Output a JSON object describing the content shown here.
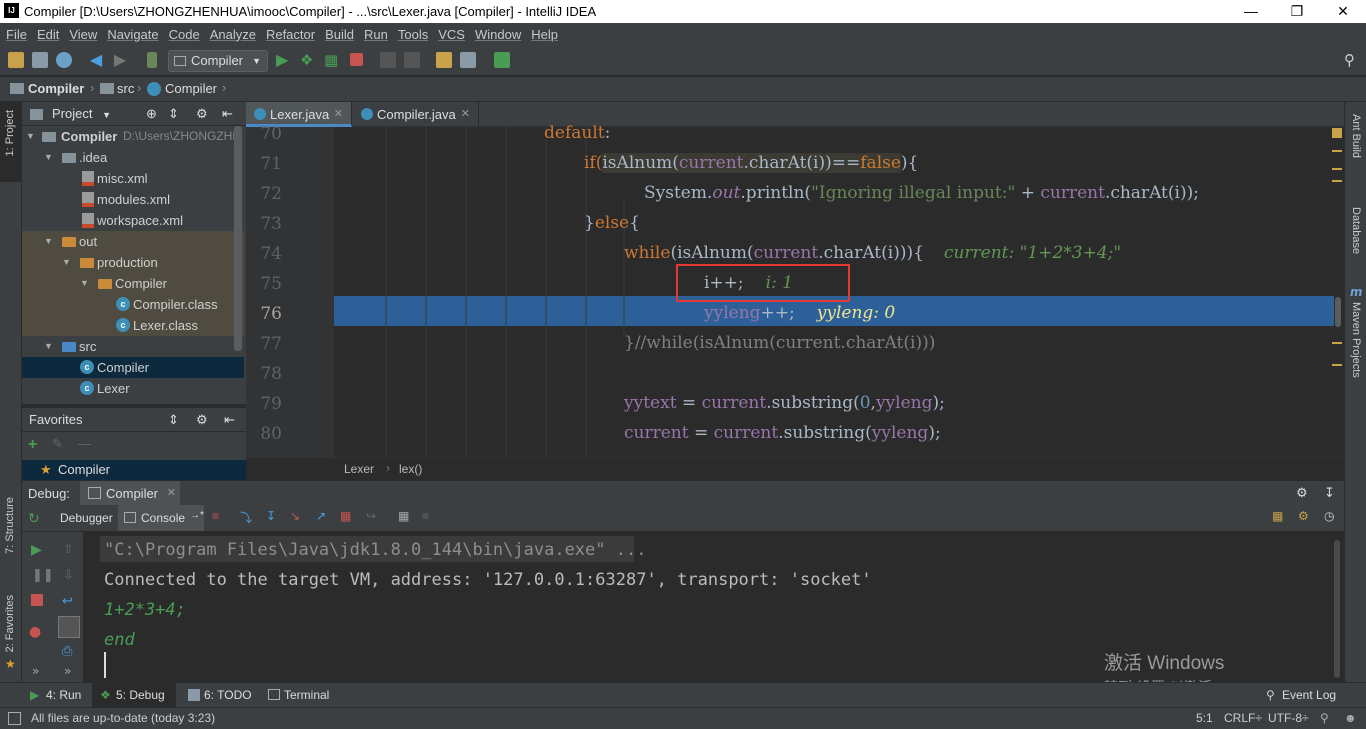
{
  "window": {
    "title": "Compiler [D:\\Users\\ZHONGZHENHUA\\imooc\\Compiler] - ...\\src\\Lexer.java [Compiler] - IntelliJ IDEA",
    "app_icon": "IJ"
  },
  "menu": [
    "File",
    "Edit",
    "View",
    "Navigate",
    "Code",
    "Analyze",
    "Refactor",
    "Build",
    "Run",
    "Tools",
    "VCS",
    "Window",
    "Help"
  ],
  "toolbar": {
    "run_config": "Compiler"
  },
  "navbar": {
    "items": [
      "Compiler",
      "src",
      "Compiler"
    ]
  },
  "left_strip": {
    "project": "1: Project",
    "structure": "7: Structure",
    "favorites": "2: Favorites"
  },
  "right_strip": {
    "ant": "Ant Build",
    "database": "Database",
    "maven": "Maven Projects"
  },
  "project_panel": {
    "title": "Project",
    "root": {
      "name": "Compiler",
      "path": "D:\\Users\\ZHONGZHE"
    },
    "items": [
      ".idea",
      "misc.xml",
      "modules.xml",
      "workspace.xml",
      "out",
      "production",
      "Compiler",
      "Compiler.class",
      "Lexer.class",
      "src",
      "Compiler",
      "Lexer"
    ]
  },
  "favorites_panel": {
    "title": "Favorites",
    "item": "Compiler"
  },
  "editor": {
    "tabs": [
      "Lexer.java",
      "Compiler.java"
    ],
    "line_numbers": [
      "70",
      "71",
      "72",
      "73",
      "74",
      "75",
      "76",
      "77",
      "78",
      "79",
      "80"
    ],
    "lines": {
      "l70": [
        "default",
        ":"
      ],
      "l71": [
        "if(",
        "isAlnum(",
        "current",
        ".charAt(i))==",
        "false",
        "){"
      ],
      "l72": [
        "System.",
        "out",
        ".println(",
        "\"Ignoring illegal input:\"",
        " + ",
        "current",
        ".charAt(i));"
      ],
      "l73": [
        "}",
        "else",
        "{"
      ],
      "l74": [
        "while",
        "(isAlnum(",
        "current",
        ".charAt(i))){",
        "current: \"1+2*3+4;\""
      ],
      "l75": [
        "i++;",
        "i: 1"
      ],
      "l76": [
        "yyleng",
        "++;",
        "yyleng: 0"
      ],
      "l77": [
        "}//while(isAlnum(current.charAt(i)))"
      ],
      "l79": [
        "yytext",
        " = ",
        "current",
        ".substring(",
        "0",
        ",",
        "yyleng",
        ");"
      ],
      "l80": [
        "current",
        " = ",
        "current",
        ".substring(",
        "yyleng",
        ");"
      ]
    },
    "breadcrumb": [
      "Lexer",
      "lex()"
    ]
  },
  "debug": {
    "label": "Debug:",
    "session": "Compiler",
    "tabs": [
      "Debugger",
      "Console"
    ],
    "console_lines": [
      "\"C:\\Program Files\\Java\\jdk1.8.0_144\\bin\\java.exe\" ...",
      "Connected to the target VM, address: '127.0.0.1:63287', transport: 'socket'",
      "1+2*3+4;",
      "end"
    ]
  },
  "bottom_tabs": [
    "4: Run",
    "5: Debug",
    "6: TODO",
    "Terminal"
  ],
  "event_log": "Event Log",
  "status": {
    "message": "All files are up-to-date (today 3:23)",
    "position": "5:1",
    "line_sep": "CRLF÷",
    "encoding": "UTF-8÷"
  },
  "watermark": {
    "line1": "激活 Windows",
    "line2": "转到\"设置\"以激活 Windows。"
  },
  "colors": {
    "execution_line": "#2d6099",
    "keyword": "#cc7832",
    "string": "#6a8759",
    "highlight_box": "#e53935"
  }
}
